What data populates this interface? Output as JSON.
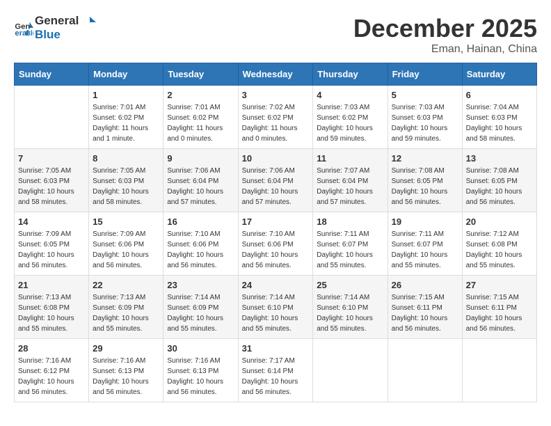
{
  "logo": {
    "line1": "General",
    "line2": "Blue"
  },
  "title": "December 2025",
  "location": "Eman, Hainan, China",
  "days_of_week": [
    "Sunday",
    "Monday",
    "Tuesday",
    "Wednesday",
    "Thursday",
    "Friday",
    "Saturday"
  ],
  "weeks": [
    [
      {
        "day": "",
        "info": ""
      },
      {
        "day": "1",
        "info": "Sunrise: 7:01 AM\nSunset: 6:02 PM\nDaylight: 11 hours\nand 1 minute."
      },
      {
        "day": "2",
        "info": "Sunrise: 7:01 AM\nSunset: 6:02 PM\nDaylight: 11 hours\nand 0 minutes."
      },
      {
        "day": "3",
        "info": "Sunrise: 7:02 AM\nSunset: 6:02 PM\nDaylight: 11 hours\nand 0 minutes."
      },
      {
        "day": "4",
        "info": "Sunrise: 7:03 AM\nSunset: 6:02 PM\nDaylight: 10 hours\nand 59 minutes."
      },
      {
        "day": "5",
        "info": "Sunrise: 7:03 AM\nSunset: 6:03 PM\nDaylight: 10 hours\nand 59 minutes."
      },
      {
        "day": "6",
        "info": "Sunrise: 7:04 AM\nSunset: 6:03 PM\nDaylight: 10 hours\nand 58 minutes."
      }
    ],
    [
      {
        "day": "7",
        "info": "Sunrise: 7:05 AM\nSunset: 6:03 PM\nDaylight: 10 hours\nand 58 minutes."
      },
      {
        "day": "8",
        "info": "Sunrise: 7:05 AM\nSunset: 6:03 PM\nDaylight: 10 hours\nand 58 minutes."
      },
      {
        "day": "9",
        "info": "Sunrise: 7:06 AM\nSunset: 6:04 PM\nDaylight: 10 hours\nand 57 minutes."
      },
      {
        "day": "10",
        "info": "Sunrise: 7:06 AM\nSunset: 6:04 PM\nDaylight: 10 hours\nand 57 minutes."
      },
      {
        "day": "11",
        "info": "Sunrise: 7:07 AM\nSunset: 6:04 PM\nDaylight: 10 hours\nand 57 minutes."
      },
      {
        "day": "12",
        "info": "Sunrise: 7:08 AM\nSunset: 6:05 PM\nDaylight: 10 hours\nand 56 minutes."
      },
      {
        "day": "13",
        "info": "Sunrise: 7:08 AM\nSunset: 6:05 PM\nDaylight: 10 hours\nand 56 minutes."
      }
    ],
    [
      {
        "day": "14",
        "info": "Sunrise: 7:09 AM\nSunset: 6:05 PM\nDaylight: 10 hours\nand 56 minutes."
      },
      {
        "day": "15",
        "info": "Sunrise: 7:09 AM\nSunset: 6:06 PM\nDaylight: 10 hours\nand 56 minutes."
      },
      {
        "day": "16",
        "info": "Sunrise: 7:10 AM\nSunset: 6:06 PM\nDaylight: 10 hours\nand 56 minutes."
      },
      {
        "day": "17",
        "info": "Sunrise: 7:10 AM\nSunset: 6:06 PM\nDaylight: 10 hours\nand 56 minutes."
      },
      {
        "day": "18",
        "info": "Sunrise: 7:11 AM\nSunset: 6:07 PM\nDaylight: 10 hours\nand 55 minutes."
      },
      {
        "day": "19",
        "info": "Sunrise: 7:11 AM\nSunset: 6:07 PM\nDaylight: 10 hours\nand 55 minutes."
      },
      {
        "day": "20",
        "info": "Sunrise: 7:12 AM\nSunset: 6:08 PM\nDaylight: 10 hours\nand 55 minutes."
      }
    ],
    [
      {
        "day": "21",
        "info": "Sunrise: 7:13 AM\nSunset: 6:08 PM\nDaylight: 10 hours\nand 55 minutes."
      },
      {
        "day": "22",
        "info": "Sunrise: 7:13 AM\nSunset: 6:09 PM\nDaylight: 10 hours\nand 55 minutes."
      },
      {
        "day": "23",
        "info": "Sunrise: 7:14 AM\nSunset: 6:09 PM\nDaylight: 10 hours\nand 55 minutes."
      },
      {
        "day": "24",
        "info": "Sunrise: 7:14 AM\nSunset: 6:10 PM\nDaylight: 10 hours\nand 55 minutes."
      },
      {
        "day": "25",
        "info": "Sunrise: 7:14 AM\nSunset: 6:10 PM\nDaylight: 10 hours\nand 55 minutes."
      },
      {
        "day": "26",
        "info": "Sunrise: 7:15 AM\nSunset: 6:11 PM\nDaylight: 10 hours\nand 56 minutes."
      },
      {
        "day": "27",
        "info": "Sunrise: 7:15 AM\nSunset: 6:11 PM\nDaylight: 10 hours\nand 56 minutes."
      }
    ],
    [
      {
        "day": "28",
        "info": "Sunrise: 7:16 AM\nSunset: 6:12 PM\nDaylight: 10 hours\nand 56 minutes."
      },
      {
        "day": "29",
        "info": "Sunrise: 7:16 AM\nSunset: 6:13 PM\nDaylight: 10 hours\nand 56 minutes."
      },
      {
        "day": "30",
        "info": "Sunrise: 7:16 AM\nSunset: 6:13 PM\nDaylight: 10 hours\nand 56 minutes."
      },
      {
        "day": "31",
        "info": "Sunrise: 7:17 AM\nSunset: 6:14 PM\nDaylight: 10 hours\nand 56 minutes."
      },
      {
        "day": "",
        "info": ""
      },
      {
        "day": "",
        "info": ""
      },
      {
        "day": "",
        "info": ""
      }
    ]
  ]
}
